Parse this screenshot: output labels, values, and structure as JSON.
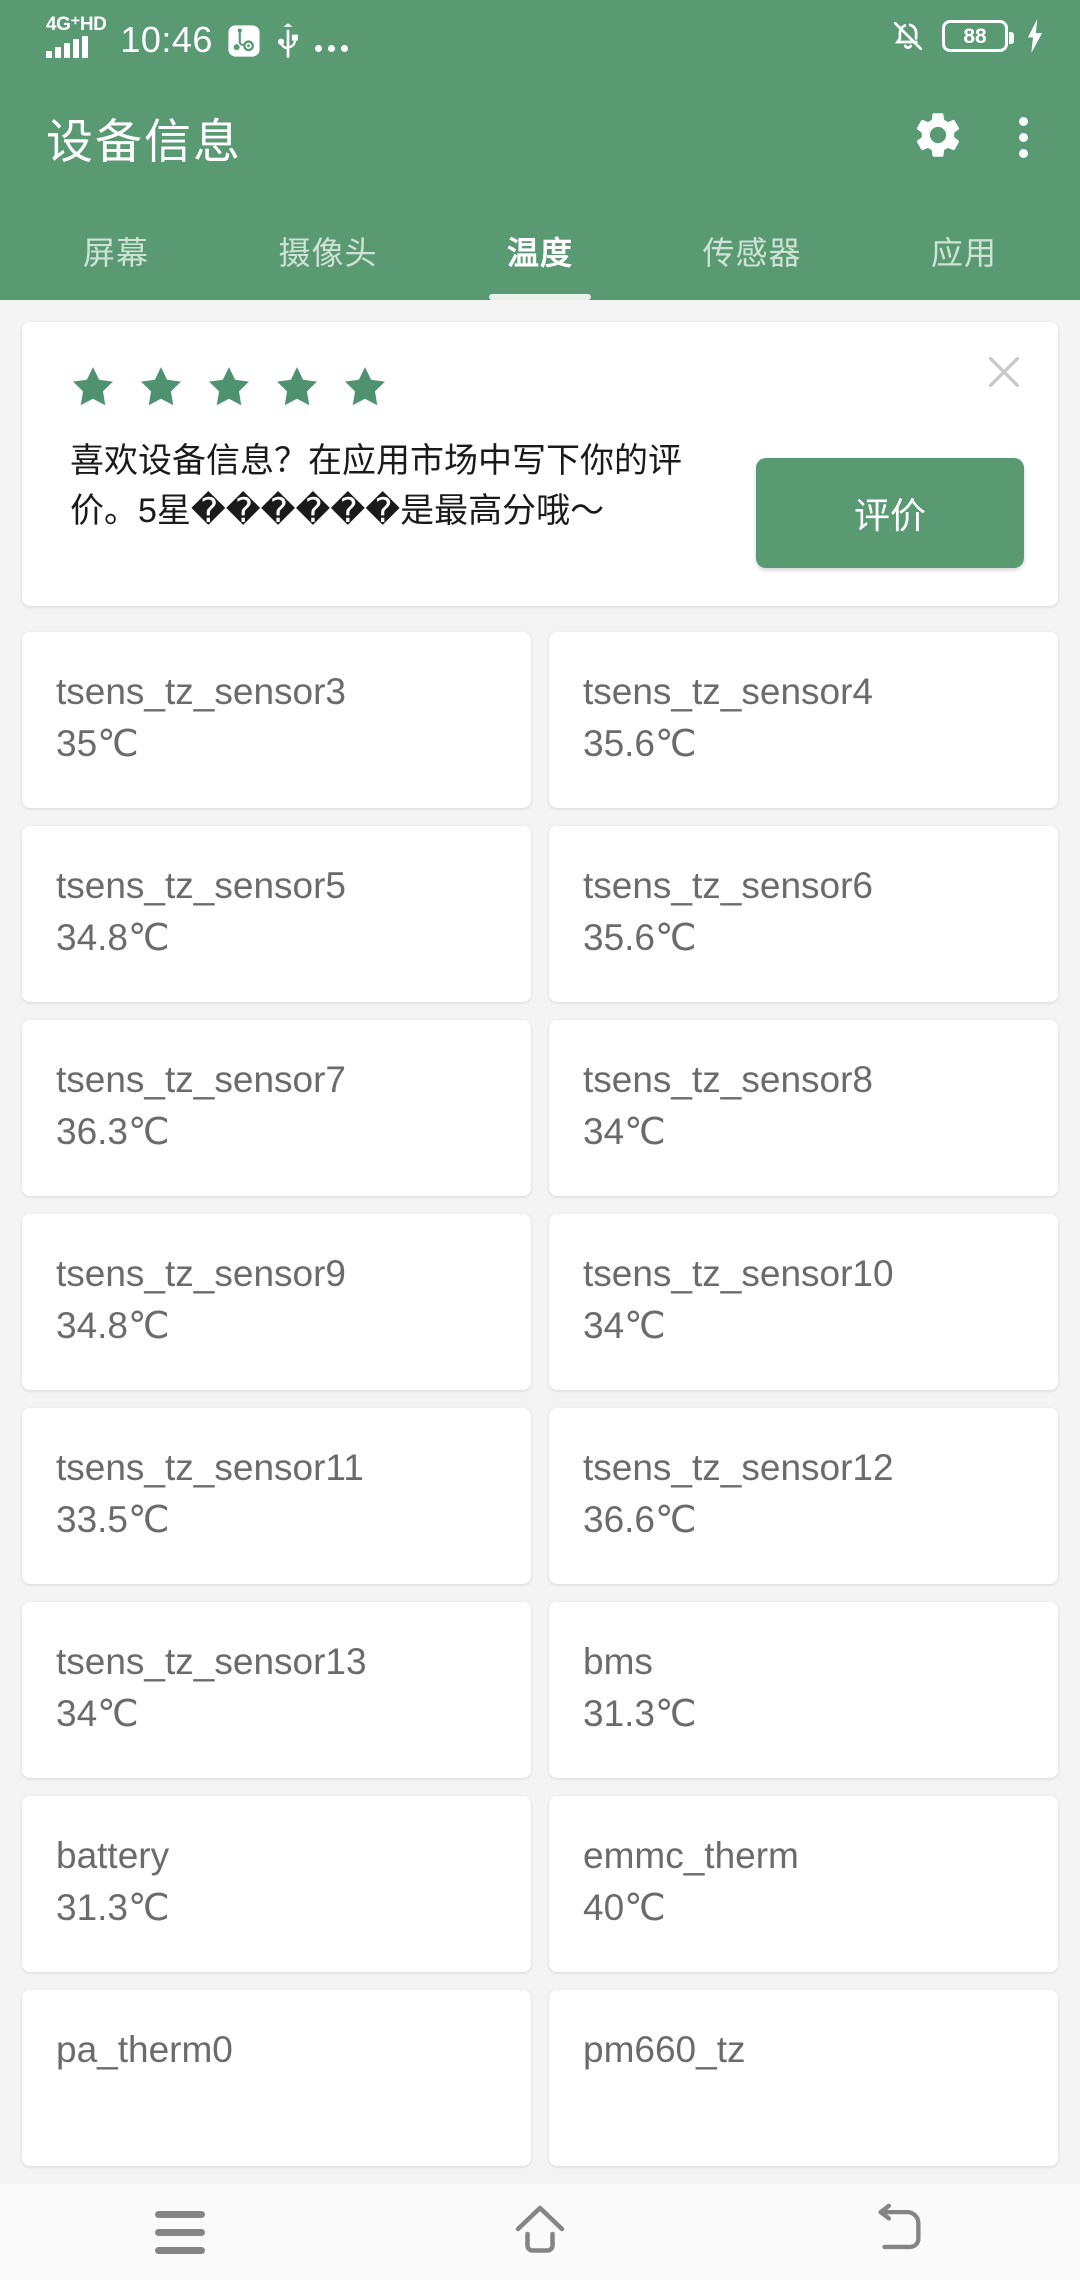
{
  "theme": {
    "primary": "#599a73",
    "page_bg": "#f4f4f4",
    "card_bg": "#ffffff",
    "card_text": "#6b6b6b",
    "tab_inactive": "#cfe2d6"
  },
  "status_bar": {
    "network": "4G⁺HD",
    "time": "10:46",
    "usb_debug_icon": "usb-debug-icon",
    "usb_icon": "usb-icon",
    "more_icon": "more-dots-icon",
    "silent_icon": "bell-off-icon",
    "battery_level": "88",
    "charging_icon": "charging-bolt-icon"
  },
  "app_bar": {
    "title": "设备信息",
    "settings_icon": "gear-icon",
    "overflow_icon": "overflow-menu-icon"
  },
  "tabs": {
    "active_index": 2,
    "items": [
      {
        "label": "屏幕"
      },
      {
        "label": "摄像头"
      },
      {
        "label": "温度"
      },
      {
        "label": "传感器"
      },
      {
        "label": "应用"
      }
    ]
  },
  "rating_card": {
    "stars": 5,
    "message": "喜欢设备信息？在应用市场中写下你的评价。5星������是最高分哦～",
    "button_label": "评价",
    "close_icon": "close-icon"
  },
  "sensors": [
    {
      "name": "tsens_tz_sensor3",
      "value": "35℃"
    },
    {
      "name": "tsens_tz_sensor4",
      "value": "35.6℃"
    },
    {
      "name": "tsens_tz_sensor5",
      "value": "34.8℃"
    },
    {
      "name": "tsens_tz_sensor6",
      "value": "35.6℃"
    },
    {
      "name": "tsens_tz_sensor7",
      "value": "36.3℃"
    },
    {
      "name": "tsens_tz_sensor8",
      "value": "34℃"
    },
    {
      "name": "tsens_tz_sensor9",
      "value": "34.8℃"
    },
    {
      "name": "tsens_tz_sensor10",
      "value": "34℃"
    },
    {
      "name": "tsens_tz_sensor11",
      "value": "33.5℃"
    },
    {
      "name": "tsens_tz_sensor12",
      "value": "36.6℃"
    },
    {
      "name": "tsens_tz_sensor13",
      "value": "34℃"
    },
    {
      "name": "bms",
      "value": "31.3℃"
    },
    {
      "name": "battery",
      "value": "31.3℃"
    },
    {
      "name": "emmc_therm",
      "value": "40℃"
    },
    {
      "name": "pa_therm0",
      "value": ""
    },
    {
      "name": "pm660_tz",
      "value": ""
    }
  ],
  "nav_bar": {
    "recents_icon": "recents-menu-icon",
    "home_icon": "home-icon",
    "back_icon": "back-arrow-icon"
  }
}
